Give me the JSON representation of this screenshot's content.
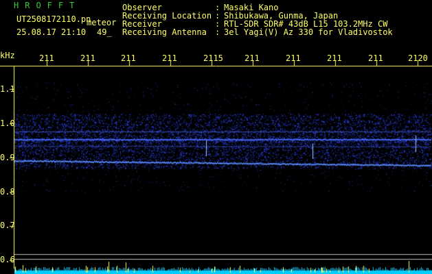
{
  "header": {
    "app_title": "HROFFT",
    "filename": "UT2508172110.pn",
    "filename_suffix": "meteor",
    "datetime": "25.08.17 21:10",
    "time_suffix": "49_"
  },
  "info": [
    {
      "label": "Observer",
      "value": "Masaki Kano"
    },
    {
      "label": "Receiving Location",
      "value": "Shibukawa, Gunma, Japan"
    },
    {
      "label": "Receiver",
      "value": "RTL-SDR SDR# 43dB L15 103.2MHz CW"
    },
    {
      "label": "Receiving Antenna",
      "value": "3el Yagi(V) Az 330 for Vladivostok"
    }
  ],
  "axis": {
    "y_unit": "kHz",
    "y_ticks": [
      "1.1",
      "1.0",
      "0.9",
      "0.8",
      "0.7",
      "0.6"
    ],
    "x_ticks": [
      "211",
      "211",
      "211",
      "211",
      "2115",
      "211",
      "211",
      "211",
      "211",
      "2120"
    ]
  },
  "colors": {
    "text_yellow": "#ffff66",
    "title_green": "#33cc33",
    "signal_blue": "#3355ff",
    "baseline_cyan": "#00ccff"
  }
}
